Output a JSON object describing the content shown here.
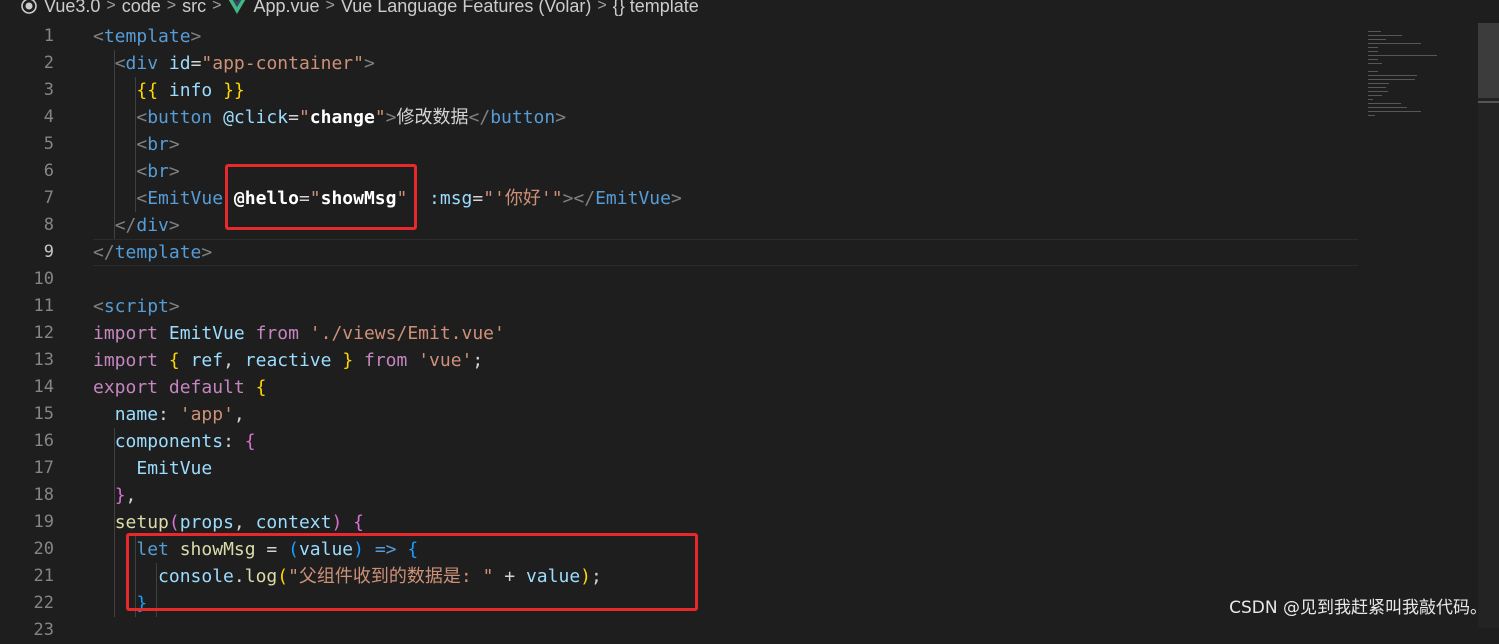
{
  "breadcrumb": {
    "items": [
      "Vue3.0",
      "code",
      "src",
      "App.vue",
      "Vue Language Features (Volar)",
      "{} template"
    ],
    "separator": ">"
  },
  "editor": {
    "active_line": 9,
    "lines": [
      {
        "n": "1",
        "tokens": [
          [
            "t-tag",
            "<"
          ],
          [
            "t-tn",
            "template"
          ],
          [
            "t-tag",
            ">"
          ]
        ]
      },
      {
        "n": "2",
        "tokens": [
          [
            "t-w",
            "  "
          ],
          [
            "t-tag",
            "<"
          ],
          [
            "t-tn",
            "div"
          ],
          [
            "t-w",
            " "
          ],
          [
            "t-attr",
            "id"
          ],
          [
            "t-w",
            "="
          ],
          [
            "t-str",
            "\"app-container\""
          ],
          [
            "t-tag",
            ">"
          ]
        ]
      },
      {
        "n": "3",
        "tokens": [
          [
            "t-w",
            "    "
          ],
          [
            "t-br1",
            "{{"
          ],
          [
            "t-w",
            " "
          ],
          [
            "t-var",
            "info"
          ],
          [
            "t-w",
            " "
          ],
          [
            "t-br1",
            "}}"
          ]
        ]
      },
      {
        "n": "4",
        "tokens": [
          [
            "t-w",
            "    "
          ],
          [
            "t-tag",
            "<"
          ],
          [
            "t-tn",
            "button"
          ],
          [
            "t-w",
            " "
          ],
          [
            "t-attr",
            "@click"
          ],
          [
            "t-w",
            "="
          ],
          [
            "t-str",
            "\""
          ],
          [
            "t-bold",
            "change"
          ],
          [
            "t-str",
            "\""
          ],
          [
            "t-tag",
            ">"
          ],
          [
            "t-w",
            "修改数据"
          ],
          [
            "t-tag",
            "</"
          ],
          [
            "t-tn",
            "button"
          ],
          [
            "t-tag",
            ">"
          ]
        ]
      },
      {
        "n": "5",
        "tokens": [
          [
            "t-w",
            "    "
          ],
          [
            "t-tag",
            "<"
          ],
          [
            "t-tn",
            "br"
          ],
          [
            "t-tag",
            ">"
          ]
        ]
      },
      {
        "n": "6",
        "tokens": [
          [
            "t-w",
            "    "
          ],
          [
            "t-tag",
            "<"
          ],
          [
            "t-tn",
            "br"
          ],
          [
            "t-tag",
            ">"
          ]
        ]
      },
      {
        "n": "7",
        "tokens": [
          [
            "t-w",
            "    "
          ],
          [
            "t-tag",
            "<"
          ],
          [
            "t-tn",
            "EmitVue"
          ],
          [
            "t-w",
            " "
          ],
          [
            "t-bold",
            "@hello"
          ],
          [
            "t-w",
            "="
          ],
          [
            "t-str",
            "\""
          ],
          [
            "t-bold",
            "showMsg"
          ],
          [
            "t-str",
            "\""
          ],
          [
            "t-w",
            "  "
          ],
          [
            "t-attr",
            ":msg"
          ],
          [
            "t-w",
            "="
          ],
          [
            "t-str",
            "\"'你好'\""
          ],
          [
            "t-tag",
            "></"
          ],
          [
            "t-tn",
            "EmitVue"
          ],
          [
            "t-tag",
            ">"
          ]
        ]
      },
      {
        "n": "8",
        "tokens": [
          [
            "t-w",
            "  "
          ],
          [
            "t-tag",
            "</"
          ],
          [
            "t-tn",
            "div"
          ],
          [
            "t-tag",
            ">"
          ]
        ]
      },
      {
        "n": "9",
        "tokens": [
          [
            "t-tag",
            "</"
          ],
          [
            "t-tn",
            "template"
          ],
          [
            "t-tag",
            ">"
          ]
        ]
      },
      {
        "n": "10",
        "tokens": []
      },
      {
        "n": "11",
        "tokens": [
          [
            "t-tag",
            "<"
          ],
          [
            "t-tn",
            "script"
          ],
          [
            "t-tag",
            ">"
          ]
        ]
      },
      {
        "n": "12",
        "tokens": [
          [
            "t-kw",
            "import"
          ],
          [
            "t-w",
            " "
          ],
          [
            "t-var",
            "EmitVue"
          ],
          [
            "t-w",
            " "
          ],
          [
            "t-kw",
            "from"
          ],
          [
            "t-w",
            " "
          ],
          [
            "t-str",
            "'./views/Emit.vue'"
          ]
        ]
      },
      {
        "n": "13",
        "tokens": [
          [
            "t-kw",
            "import"
          ],
          [
            "t-w",
            " "
          ],
          [
            "t-br1",
            "{"
          ],
          [
            "t-w",
            " "
          ],
          [
            "t-var",
            "ref"
          ],
          [
            "t-w",
            ", "
          ],
          [
            "t-var",
            "reactive"
          ],
          [
            "t-w",
            " "
          ],
          [
            "t-br1",
            "}"
          ],
          [
            "t-w",
            " "
          ],
          [
            "t-kw",
            "from"
          ],
          [
            "t-w",
            " "
          ],
          [
            "t-str",
            "'vue'"
          ],
          [
            "t-w",
            ";"
          ]
        ]
      },
      {
        "n": "14",
        "tokens": [
          [
            "t-kw",
            "export"
          ],
          [
            "t-w",
            " "
          ],
          [
            "t-kw",
            "default"
          ],
          [
            "t-w",
            " "
          ],
          [
            "t-br1",
            "{"
          ]
        ]
      },
      {
        "n": "15",
        "tokens": [
          [
            "t-w",
            "  "
          ],
          [
            "t-var",
            "name"
          ],
          [
            "t-w",
            ": "
          ],
          [
            "t-str",
            "'app'"
          ],
          [
            "t-w",
            ","
          ]
        ]
      },
      {
        "n": "16",
        "tokens": [
          [
            "t-w",
            "  "
          ],
          [
            "t-var",
            "components"
          ],
          [
            "t-w",
            ": "
          ],
          [
            "t-br2",
            "{"
          ]
        ]
      },
      {
        "n": "17",
        "tokens": [
          [
            "t-w",
            "    "
          ],
          [
            "t-var",
            "EmitVue"
          ]
        ]
      },
      {
        "n": "18",
        "tokens": [
          [
            "t-w",
            "  "
          ],
          [
            "t-br2",
            "}"
          ],
          [
            "t-w",
            ","
          ]
        ]
      },
      {
        "n": "19",
        "tokens": [
          [
            "t-w",
            "  "
          ],
          [
            "t-fn",
            "setup"
          ],
          [
            "t-br2",
            "("
          ],
          [
            "t-var",
            "props"
          ],
          [
            "t-w",
            ", "
          ],
          [
            "t-var",
            "context"
          ],
          [
            "t-br2",
            ")"
          ],
          [
            "t-w",
            " "
          ],
          [
            "t-br2",
            "{"
          ]
        ]
      },
      {
        "n": "20",
        "tokens": [
          [
            "t-w",
            "    "
          ],
          [
            "t-kwb",
            "let"
          ],
          [
            "t-w",
            " "
          ],
          [
            "t-fn",
            "showMsg"
          ],
          [
            "t-w",
            " = "
          ],
          [
            "t-br3",
            "("
          ],
          [
            "t-var",
            "value"
          ],
          [
            "t-br3",
            ")"
          ],
          [
            "t-w",
            " "
          ],
          [
            "t-kwb",
            "=>"
          ],
          [
            "t-w",
            " "
          ],
          [
            "t-br3",
            "{"
          ]
        ]
      },
      {
        "n": "21",
        "tokens": [
          [
            "t-w",
            "      "
          ],
          [
            "t-var",
            "console"
          ],
          [
            "t-w",
            "."
          ],
          [
            "t-fn",
            "log"
          ],
          [
            "t-br1",
            "("
          ],
          [
            "t-str",
            "\"父组件收到的数据是: \""
          ],
          [
            "t-w",
            " + "
          ],
          [
            "t-var",
            "value"
          ],
          [
            "t-br1",
            ")"
          ],
          [
            "t-w",
            ";"
          ]
        ]
      },
      {
        "n": "22",
        "tokens": [
          [
            "t-w",
            "    "
          ],
          [
            "t-br3",
            "}"
          ]
        ]
      },
      {
        "n": "23",
        "tokens": []
      }
    ]
  },
  "colors": {
    "background": "#1e1e1e",
    "highlight_box": "#e8292b",
    "vue_logo_outer": "#41b883",
    "vue_logo_inner": "#35495e"
  },
  "watermark": "CSDN @见到我赶紧叫我敲代码。"
}
